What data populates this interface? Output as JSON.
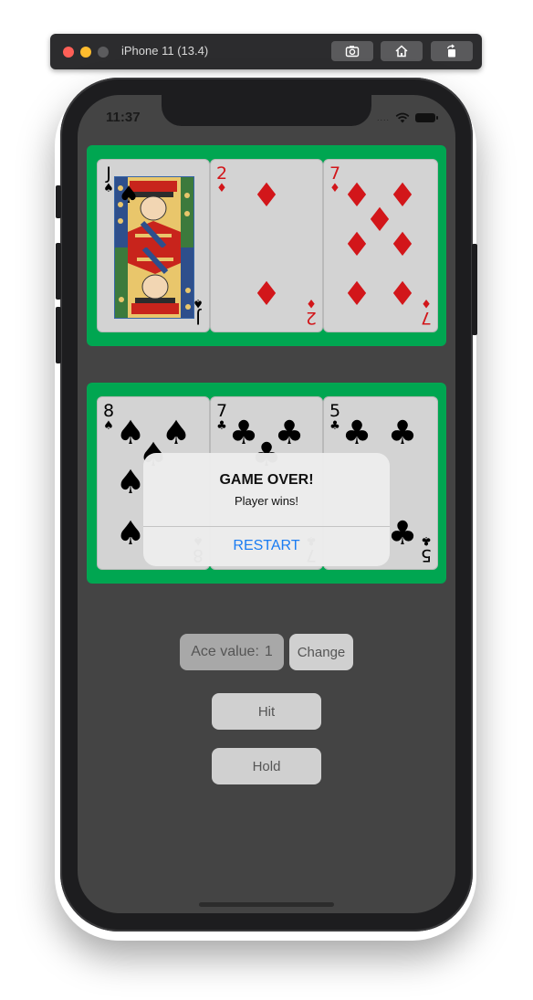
{
  "simulator": {
    "title": "iPhone 11 (13.4)",
    "buttons": [
      "screenshot-icon",
      "home-icon",
      "rotate-icon"
    ]
  },
  "status_bar": {
    "time": "11:37",
    "signal": "....",
    "icons": [
      "wifi-icon",
      "battery-icon"
    ]
  },
  "dealer": {
    "cards": [
      {
        "rank": "J",
        "suit": "♠",
        "suit_name": "spades",
        "color": "#000000"
      },
      {
        "rank": "2",
        "suit": "♦",
        "suit_name": "diamonds",
        "color": "#d2161a"
      },
      {
        "rank": "7",
        "suit": "♦",
        "suit_name": "diamonds",
        "color": "#d2161a"
      }
    ]
  },
  "player": {
    "cards": [
      {
        "rank": "8",
        "suit": "♠",
        "suit_name": "spades",
        "color": "#000000"
      },
      {
        "rank": "7",
        "suit": "♣",
        "suit_name": "clubs",
        "color": "#000000"
      },
      {
        "rank": "5",
        "suit": "♣",
        "suit_name": "clubs",
        "color": "#000000"
      }
    ]
  },
  "dialog": {
    "title": "GAME OVER!",
    "message": "Player wins!",
    "button": "RESTART"
  },
  "controls": {
    "ace_label": "Ace value:",
    "ace_value": "1",
    "change_label": "Change",
    "hit_label": "Hit",
    "hold_label": "Hold"
  },
  "colors": {
    "table_felt": "#00a651",
    "screen_background": "#444444",
    "card_background": "#d3d3d3",
    "accent_blue": "#1a7cf2",
    "red_suit": "#d2161a"
  }
}
